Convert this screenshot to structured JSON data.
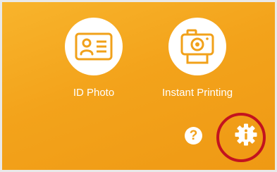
{
  "menu": {
    "items": [
      {
        "label": "ID Photo",
        "icon": "id-card-icon"
      },
      {
        "label": "Instant Printing",
        "icon": "camera-print-icon"
      }
    ]
  },
  "actions": {
    "help": {
      "label": "?",
      "icon": "help-icon"
    },
    "info_settings": {
      "icon": "info-gear-icon"
    }
  },
  "annotation": {
    "highlight": "info-gear-icon",
    "color": "#c3131f"
  },
  "colors": {
    "accent": "#f3a31b",
    "icon_line": "#f1a11a"
  }
}
